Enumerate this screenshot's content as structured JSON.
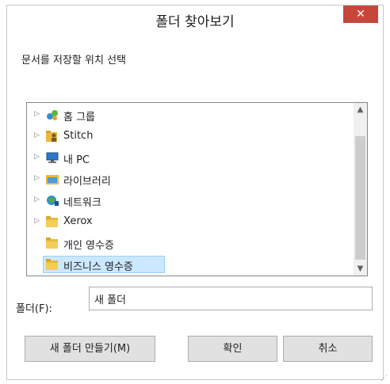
{
  "window": {
    "title": "폴더 찾아보기",
    "close_glyph": "✕"
  },
  "prompt": "문서를 저장할 위치 선택",
  "tree": {
    "items": [
      {
        "label": "홈 그룹",
        "icon": "homegroup-icon",
        "expandable": true,
        "selected": false
      },
      {
        "label": "Stitch",
        "icon": "user-folder-icon",
        "expandable": true,
        "selected": false
      },
      {
        "label": "내 PC",
        "icon": "computer-icon",
        "expandable": true,
        "selected": false
      },
      {
        "label": "라이브러리",
        "icon": "library-icon",
        "expandable": true,
        "selected": false
      },
      {
        "label": "네트워크",
        "icon": "network-icon",
        "expandable": true,
        "selected": false
      },
      {
        "label": "Xerox",
        "icon": "folder-icon",
        "expandable": true,
        "selected": false
      },
      {
        "label": "개인 영수증",
        "icon": "folder-icon",
        "expandable": false,
        "selected": false
      },
      {
        "label": "비즈니스 영수증",
        "icon": "folder-icon",
        "expandable": false,
        "selected": true
      }
    ]
  },
  "folder_field": {
    "label": "폴더(F):",
    "value": "새 폴더"
  },
  "buttons": {
    "new_folder": "새 폴더 만들기(M)",
    "ok": "확인",
    "cancel": "취소"
  },
  "colors": {
    "close": "#c7463a",
    "selection": "#cce8ff",
    "folder": "#e8b93a"
  }
}
